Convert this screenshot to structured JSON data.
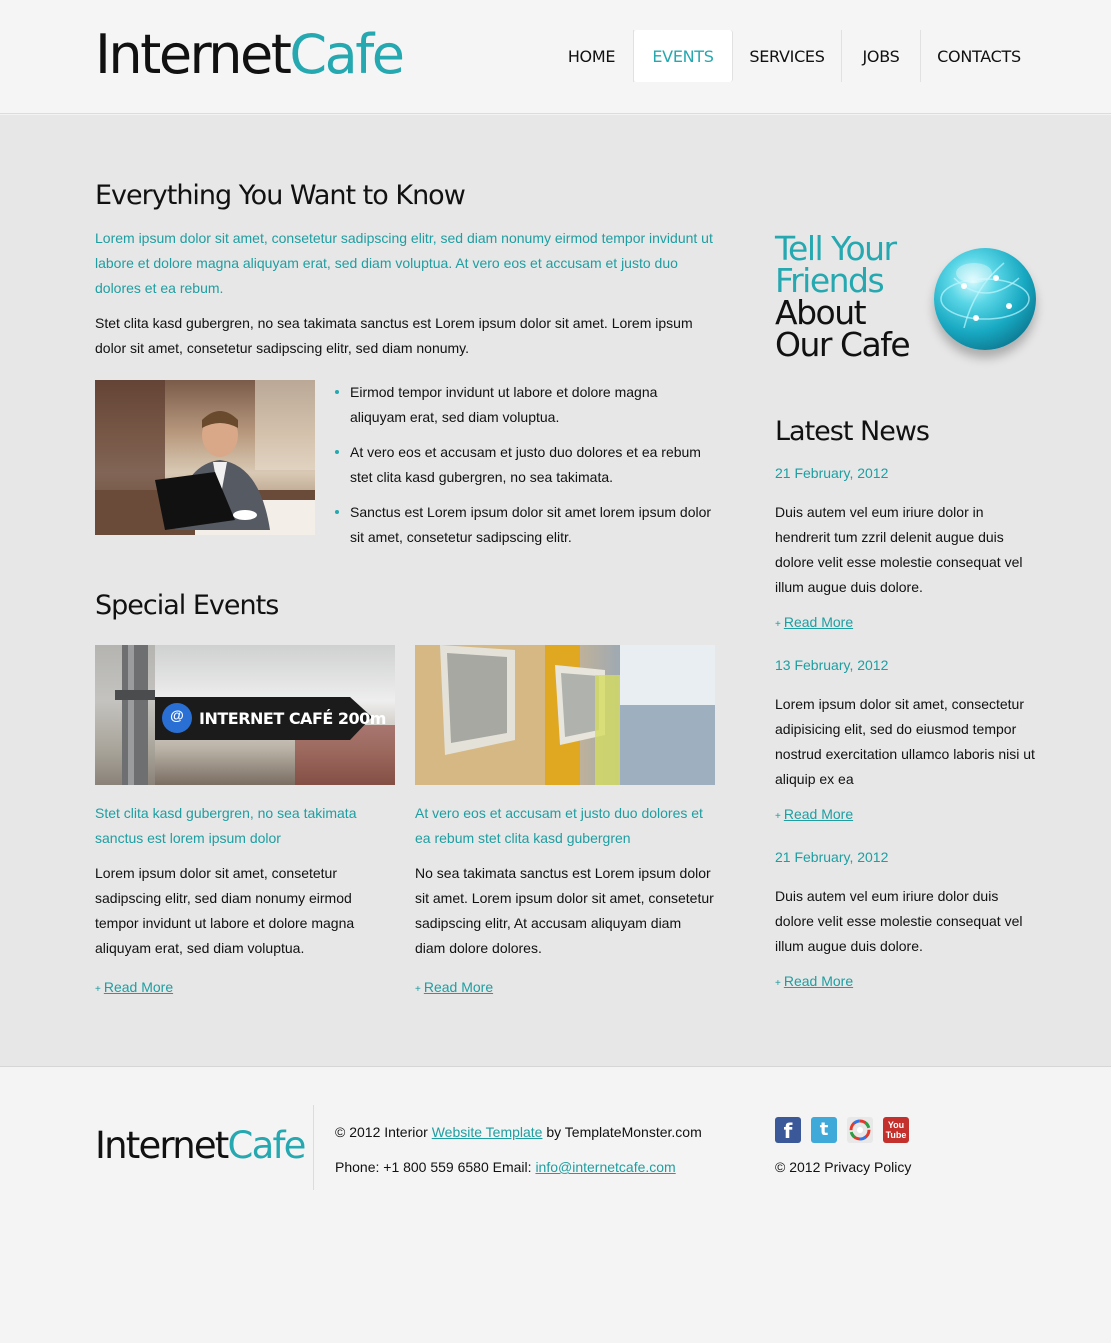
{
  "header": {
    "logo_part1": "Internet",
    "logo_part2": "Cafe",
    "nav": [
      {
        "label": "HOME"
      },
      {
        "label": "EVENTS"
      },
      {
        "label": "SERVICES"
      },
      {
        "label": "JOBS"
      },
      {
        "label": "CONTACTS"
      }
    ],
    "active_nav": "EVENTS"
  },
  "intro": {
    "title": "Everything You Want to Know",
    "lead": "Lorem ipsum dolor sit amet, consetetur sadipscing elitr, sed diam nonumy eirmod tempor invidunt ut labore et dolore magna aliquyam erat, sed diam voluptua. At vero eos et accusam et justo duo dolores et ea rebum.",
    "body": "Stet clita kasd gubergren, no sea takimata sanctus est Lorem ipsum dolor sit amet. Lorem ipsum dolor sit amet, consetetur sadipscing elitr, sed diam nonumy.",
    "bullets": [
      "Eirmod tempor invidunt ut labore et dolore magna aliquyam erat, sed diam voluptua.",
      "At vero eos et accusam et justo duo dolores et ea rebum stet clita kasd gubergren, no sea takimata.",
      "Sanctus est Lorem ipsum dolor sit amet lorem ipsum dolor sit amet, consetetur sadipscing elitr."
    ]
  },
  "events": {
    "title": "Special Events",
    "sign_text": "INTERNET CAFÉ 200m",
    "sign_at": "@",
    "items": [
      {
        "heading": "Stet clita kasd gubergren, no sea takimata sanctus est lorem ipsum dolor",
        "body": "Lorem ipsum dolor sit amet, consetetur sadipscing elitr, sed diam nonumy eirmod tempor invidunt ut labore et dolore magna aliquyam erat, sed diam voluptua.",
        "link": "Read More"
      },
      {
        "heading": "At vero eos et accusam et justo duo dolores et ea rebum stet clita kasd gubergren",
        "body": "No sea takimata sanctus est Lorem ipsum dolor sit amet. Lorem ipsum dolor sit amet, consetetur sadipscing elitr, At accusam aliquyam diam diam dolore dolores.",
        "link": "Read More"
      }
    ]
  },
  "sidebar": {
    "promo": [
      "Tell Your",
      "Friends",
      "About",
      "Our Cafe"
    ],
    "news_title": "Latest News",
    "news": [
      {
        "date": "21 February, 2012",
        "text": "Duis autem vel eum iriure dolor in hendrerit tum zzril delenit augue duis dolore velit esse molestie consequat vel illum augue duis dolore.",
        "link": "Read More"
      },
      {
        "date": "13 February, 2012",
        "text": "Lorem ipsum dolor sit amet, consectetur adipisicing elit, sed do eiusmod tempor nostrud exercitation ullamco laboris nisi ut aliquip ex ea",
        "link": "Read More"
      },
      {
        "date": "21 February, 2012",
        "text": "Duis autem vel eum iriure dolor duis dolore velit esse molestie consequat vel illum augue duis dolore.",
        "link": "Read More"
      }
    ]
  },
  "footer": {
    "logo_part1": "Internet",
    "logo_part2": "Cafe",
    "copy_prefix": "© 2012 Interior ",
    "copy_link": "Website Template",
    "copy_suffix": " by TemplateMonster.com",
    "phone_text": "Phone: +1 800 559 6580 Email: ",
    "email": "info@internetcafe.com",
    "privacy": "© 2012 Privacy Policy",
    "social": [
      {
        "icon": "facebook-icon",
        "glyph": "f",
        "color": "#3b5998"
      },
      {
        "icon": "twitter-icon",
        "glyph": "t",
        "color": "#3fa9d9"
      },
      {
        "icon": "picasa-icon",
        "glyph": "",
        "color": "#e8e8e8"
      },
      {
        "icon": "youtube-icon",
        "glyph": "You Tube",
        "color": "#c4302b"
      }
    ]
  },
  "colors": {
    "accent": "#25a8b0",
    "text": "#111111",
    "main_bg": "#e7e7e7"
  }
}
